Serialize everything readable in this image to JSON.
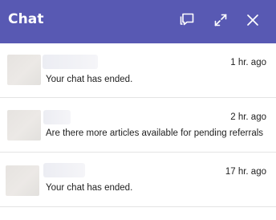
{
  "header": {
    "title": "Chat",
    "bg_color": "#5859b3",
    "buttons": [
      {
        "icon": "chat-bubbles-icon"
      },
      {
        "icon": "expand-icon"
      },
      {
        "icon": "close-icon"
      }
    ]
  },
  "conversations": [
    {
      "time": "1 hr. ago",
      "message": "Your chat has ended."
    },
    {
      "time": "2 hr. ago",
      "message": "Are there more articles available for pending referrals"
    },
    {
      "time": "17 hr. ago",
      "message": "Your chat has ended."
    }
  ]
}
